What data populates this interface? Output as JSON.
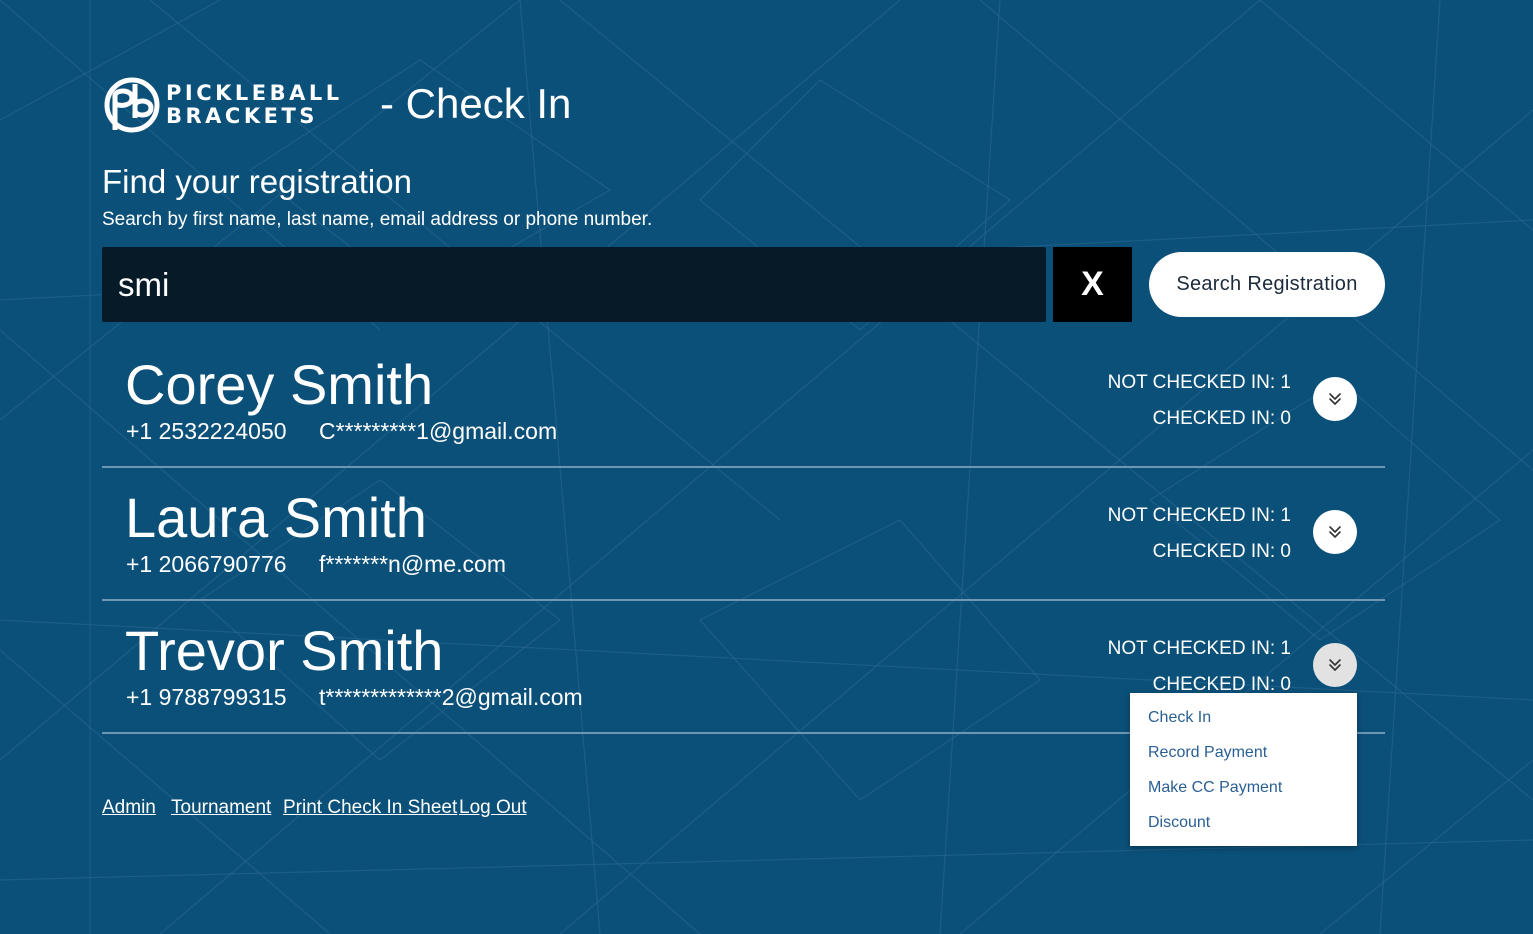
{
  "header": {
    "logo_line1": "PICKLEBALL",
    "logo_line2": "BRACKETS",
    "page_title": "- Check In"
  },
  "search": {
    "title": "Find your registration",
    "subtitle": "Search by first name, last name, email address or phone number.",
    "value": "smi",
    "placeholder": "",
    "clear_label": "X",
    "submit_label": "Search Registration"
  },
  "results": [
    {
      "name": "Corey Smith",
      "phone": "+1 2532224050",
      "email": "C*********1@gmail.com",
      "not_checked_label": "NOT CHECKED IN:",
      "not_checked_count": "1",
      "checked_label": "CHECKED IN:",
      "checked_count": "0"
    },
    {
      "name": "Laura Smith",
      "phone": "+1 2066790776",
      "email": "f*******n@me.com",
      "not_checked_label": "NOT CHECKED IN:",
      "not_checked_count": "1",
      "checked_label": "CHECKED IN:",
      "checked_count": "0"
    },
    {
      "name": "Trevor Smith",
      "phone": "+1 9788799315",
      "email": "t*************2@gmail.com",
      "not_checked_label": "NOT CHECKED IN:",
      "not_checked_count": "1",
      "checked_label": "CHECKED IN:",
      "checked_count": "0"
    }
  ],
  "dropdown": {
    "items": [
      "Check In",
      "Record Payment",
      "Make CC Payment",
      "Discount"
    ]
  },
  "footer": {
    "links": [
      "Admin",
      "Tournament",
      "Print Check In Sheet",
      "Log Out"
    ]
  },
  "colors": {
    "background": "#0b5079",
    "input_background": "#061a27",
    "link_blue": "#2a5f93",
    "divider": "#6f97b3"
  },
  "icons": {
    "expand": "double-chevron-down-icon"
  }
}
